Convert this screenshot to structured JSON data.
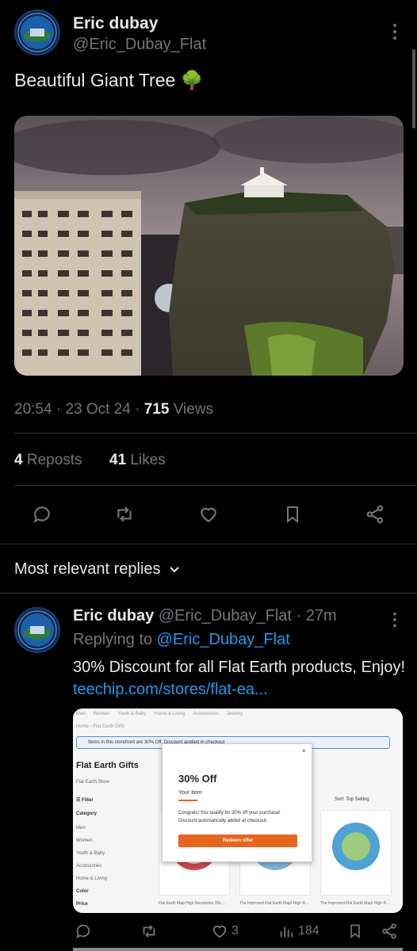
{
  "tweet": {
    "author_name": "Eric dubay",
    "author_handle": "@Eric_Dubay_Flat",
    "text": "Beautiful Giant Tree",
    "emoji": "🌳",
    "time": "20:54",
    "date": "23 Oct 24",
    "views_count": "715",
    "views_label": "Views",
    "reposts_count": "4",
    "reposts_label": "Reposts",
    "likes_count": "41",
    "likes_label": "Likes"
  },
  "replies_section": {
    "title": "Most relevant replies"
  },
  "reply": {
    "author_name": "Eric dubay",
    "author_handle": "@Eric_Dubay_Flat",
    "age": "27m",
    "replying_prefix": "Replying to",
    "replying_to": "@Eric_Dubay_Flat",
    "text": "30% Discount for all Flat Earth products, Enjoy!",
    "link": "teechip.com/stores/flat-ea...",
    "likes": "3",
    "views": "184",
    "store_card": {
      "nav": [
        "Men",
        "Women",
        "Youth & Baby",
        "Home & Living",
        "Accessories",
        "Jewelry"
      ],
      "breadcrumb": "Home › Flat Earth Gifts",
      "banner": "Items in this storefront are 30% Off. Discount applied in checkout",
      "store_title": "Flat Earth Gifts",
      "store_subtitle": "Flat Earth Store",
      "filter": "Filter",
      "category": "Category",
      "categories": [
        "Men",
        "Women",
        "Youth & Baby",
        "Accessories",
        "Home & Living"
      ],
      "color": "Color",
      "price": "Price",
      "sort": "Sort: Top Selling",
      "modal_title": "30% Off",
      "modal_subtitle": "Your Item",
      "modal_body": "Congrats! You qualify for 30% off your purchase! Discount automatically added at checkout.",
      "modal_button": "Redeem offer",
      "products": [
        "Flat Earth Map High Resolution 20x ...",
        "The Improved Flat Earth Map! High R...",
        "The Improved Flat Earth Map! High R..."
      ]
    }
  },
  "colors": {
    "background": "#000000",
    "text": "#e7e9ea",
    "secondary": "#71767b",
    "link": "#1d9bf0",
    "divider": "#2f3336",
    "accent_orange": "#e8651c"
  }
}
